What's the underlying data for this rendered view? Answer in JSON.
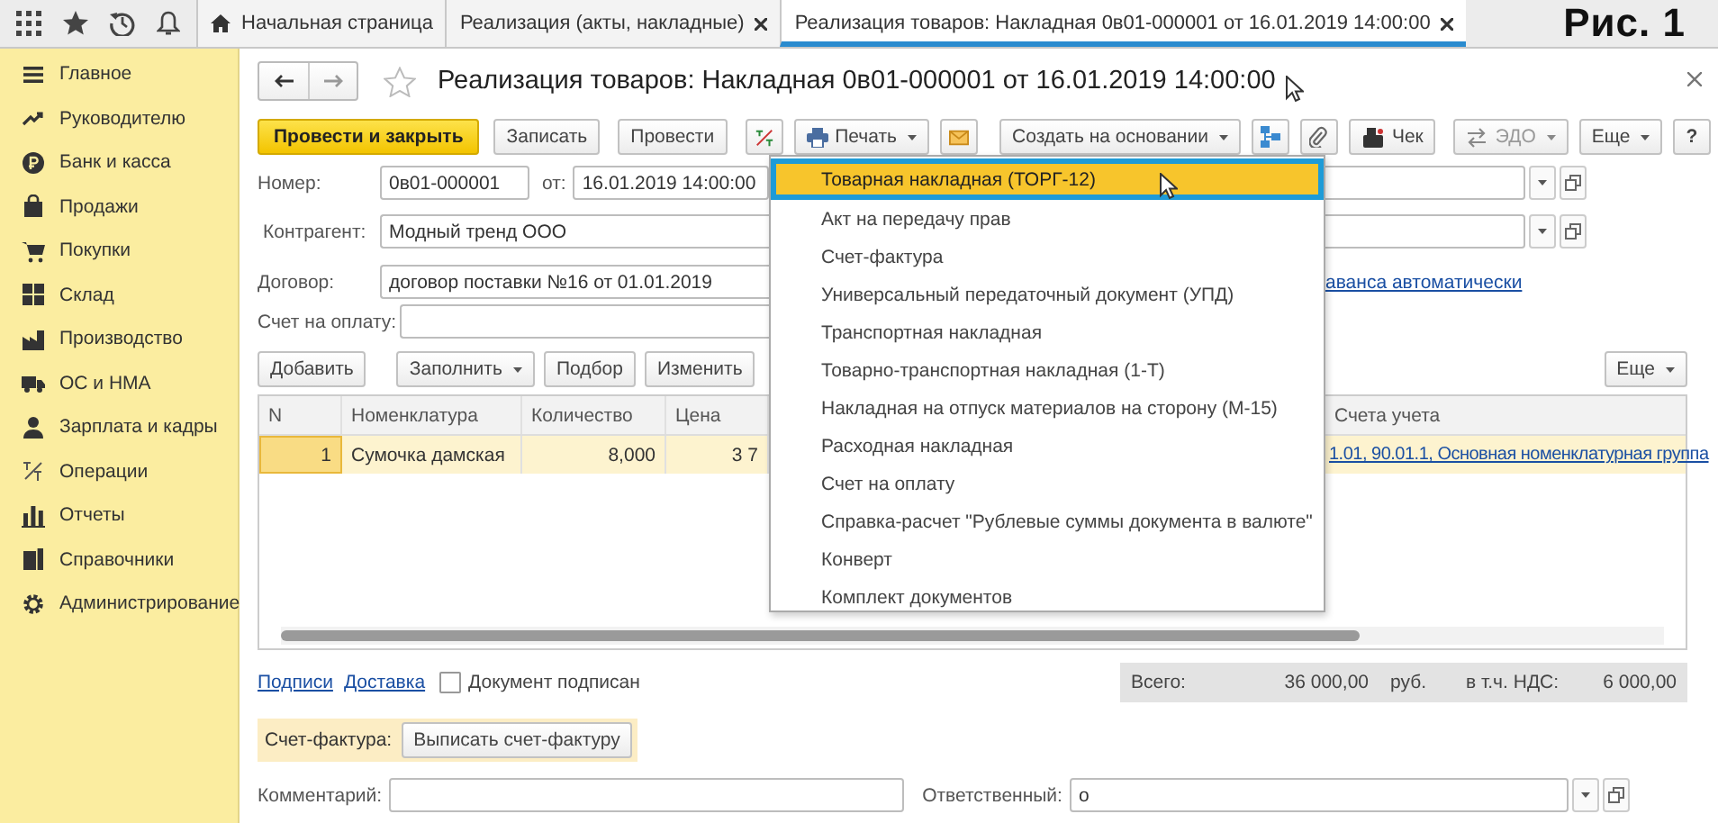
{
  "figure_label": "Рис. 1",
  "tabs": [
    {
      "label": "Начальная страница",
      "selected": false,
      "kind": "home"
    },
    {
      "label": "Реализация (акты, накладные)",
      "selected": false,
      "kind": "closable"
    },
    {
      "label": "Реализация товаров: Накладная 0в01-000001 от 16.01.2019 14:00:00",
      "selected": true,
      "kind": "closable"
    }
  ],
  "sidebar": {
    "items": [
      {
        "label": "Главное"
      },
      {
        "label": "Руководителю"
      },
      {
        "label": "Банк и касса"
      },
      {
        "label": "Продажи"
      },
      {
        "label": "Покупки"
      },
      {
        "label": "Склад"
      },
      {
        "label": "Производство"
      },
      {
        "label": "ОС и НМА"
      },
      {
        "label": "Зарплата и кадры"
      },
      {
        "label": "Операции"
      },
      {
        "label": "Отчеты"
      },
      {
        "label": "Справочники"
      },
      {
        "label": "Администрирование"
      }
    ]
  },
  "document": {
    "title": "Реализация товаров: Накладная 0в01-000001 от 16.01.2019 14:00:00",
    "toolbar": {
      "post_close": "Провести и закрыть",
      "save": "Записать",
      "post": "Провести",
      "print": "Печать",
      "create_based_on": "Создать на основании",
      "receipt": "Чек",
      "edo": {
        "label": "ЭДО",
        "disabled": true
      },
      "more": "Еще",
      "help": "?"
    },
    "number": {
      "label": "Номер:",
      "value": "0в01-000001"
    },
    "date": {
      "label": "от:",
      "value": "16.01.2019 14:00:00"
    },
    "counterparty": {
      "label": "Контрагент:",
      "value": "Модный тренд ООО"
    },
    "contract": {
      "label": "Договор:",
      "value": "договор поставки №16 от 01.01.2019",
      "link": "аванса автоматически"
    },
    "payment_invoice": {
      "label": "Счет на оплату:"
    },
    "table": {
      "buttons": [
        {
          "label": "Добавить",
          "kind": "plain"
        },
        {
          "label": "Заполнить",
          "kind": "dropdown"
        },
        {
          "label": "Подбор",
          "kind": "plain"
        },
        {
          "label": "Изменить",
          "kind": "plain"
        }
      ],
      "more": "Еще",
      "columns": [
        "N",
        "Номенклатура",
        "Количество",
        "Цена",
        "Счета учета"
      ],
      "rows": [
        {
          "selected": true,
          "cells": [
            "1",
            "Сумочка дамская",
            "8,000",
            "3 7",
            "1.01, 90.01.1, Основная номенклатурная группа"
          ]
        }
      ]
    },
    "links": [
      "Подписи",
      "Доставка"
    ],
    "signed": {
      "label": "Документ подписан",
      "checked": false
    },
    "totals": {
      "label": "Всего:",
      "amount": "36 000,00",
      "currency": "руб.",
      "vat_label": "в т.ч. НДС:",
      "vat_amount": "6 000,00"
    },
    "invoice": {
      "label": "Счет-фактура:",
      "button": "Выписать счет-фактуру"
    },
    "comment": {
      "label": "Комментарий:"
    },
    "responsible": {
      "label": "Ответственный:",
      "value": "о"
    }
  },
  "print_menu": [
    {
      "label": "Товарная накладная (ТОРГ-12)",
      "selected": true
    },
    {
      "label": "Акт на передачу прав",
      "selected": false
    },
    {
      "label": "Счет-фактура",
      "selected": false
    },
    {
      "label": "Универсальный передаточный документ (УПД)",
      "selected": false
    },
    {
      "label": "Транспортная накладная",
      "selected": false
    },
    {
      "label": "Товарно-транспортная накладная (1-Т)",
      "selected": false
    },
    {
      "label": "Накладная на отпуск материалов на сторону (М-15)",
      "selected": false
    },
    {
      "label": "Расходная накладная",
      "selected": false
    },
    {
      "label": "Счет на оплату",
      "selected": false
    },
    {
      "label": "Справка-расчет \"Рублевые суммы документа в валюте\"",
      "selected": false
    },
    {
      "label": "Конверт",
      "selected": false
    },
    {
      "label": "Комплект документов",
      "selected": false
    }
  ]
}
